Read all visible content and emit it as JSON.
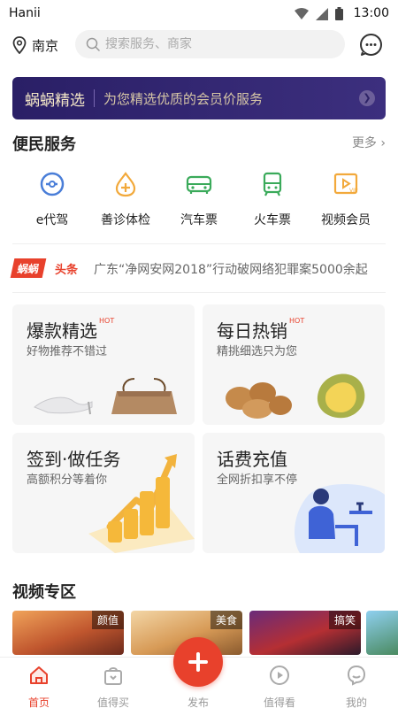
{
  "status": {
    "carrier": "Hanii",
    "time": "13:00"
  },
  "header": {
    "city": "南京",
    "search_placeholder": "搜索服务、商家"
  },
  "banner": {
    "brand": "蜗蜗精选",
    "slogan": "为您精选优质的会员价服务"
  },
  "services": {
    "title": "便民服务",
    "more": "更多",
    "items": [
      {
        "label": "e代驾",
        "icon": "e-driver-icon"
      },
      {
        "label": "善诊体检",
        "icon": "health-check-icon"
      },
      {
        "label": "汽车票",
        "icon": "bus-ticket-icon"
      },
      {
        "label": "火车票",
        "icon": "train-ticket-icon"
      },
      {
        "label": "视频会员",
        "icon": "video-vip-icon"
      }
    ]
  },
  "news": {
    "badge_a": "蜗蜗",
    "badge_b": "头条",
    "headline": "广东“净网安网2018”行动破网络犯罪案5000余起"
  },
  "cards": [
    {
      "title": "爆款精选",
      "hot": "HOT",
      "subtitle": "好物推荐不错过"
    },
    {
      "title": "每日热销",
      "hot": "HOT",
      "subtitle": "精挑细选只为您"
    },
    {
      "title": "签到·做任务",
      "subtitle": "高额积分等着你"
    },
    {
      "title": "话费充值",
      "subtitle": "全网折扣享不停"
    }
  ],
  "video": {
    "title": "视频专区",
    "thumbs": [
      {
        "tag": "颜值"
      },
      {
        "tag": "美食"
      },
      {
        "tag": "搞笑"
      }
    ]
  },
  "tabbar": {
    "items": [
      {
        "label": "首页",
        "active": true
      },
      {
        "label": "值得买",
        "active": false
      },
      {
        "label": "发布",
        "active": false
      },
      {
        "label": "值得看",
        "active": false
      },
      {
        "label": "我的",
        "active": false
      }
    ]
  },
  "colors": {
    "accent": "#e8412c",
    "banner_bg": "#2a1f66",
    "banner_text": "#f4e7c7"
  }
}
